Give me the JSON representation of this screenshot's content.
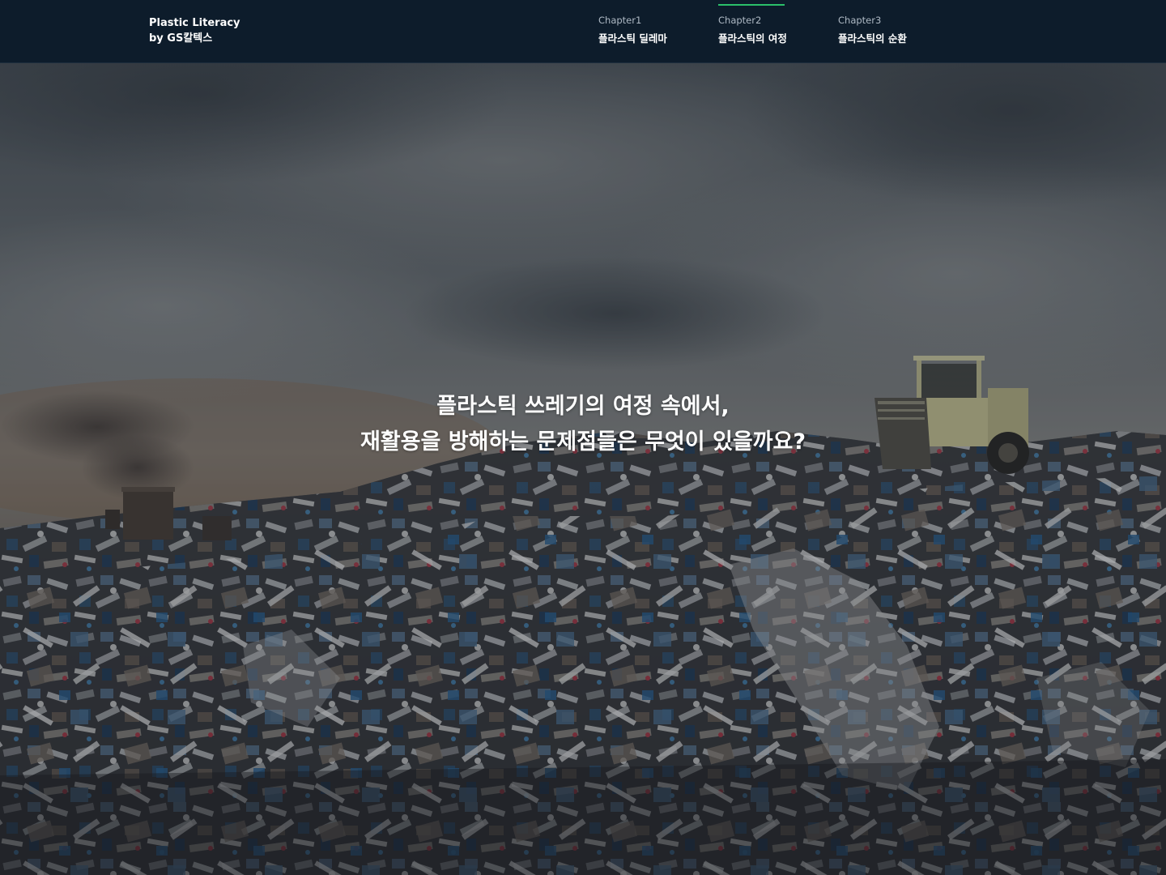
{
  "brand": {
    "line1": "Plastic Literacy",
    "line2": "by GS칼텍스"
  },
  "nav": {
    "items": [
      {
        "chapter": "Chapter1",
        "title": "플라스틱 딜레마",
        "active": false
      },
      {
        "chapter": "Chapter2",
        "title": "플라스틱의 여정",
        "active": true
      },
      {
        "chapter": "Chapter3",
        "title": "플라스틱의 순환",
        "active": false
      }
    ]
  },
  "hero": {
    "headline_line1": "플라스틱 쓰레기의 여정 속에서,",
    "headline_line2": "재활용을 방해하는 문제점들은 무엇이 있을까요?"
  },
  "colors": {
    "header_bg": "#0d1c2b",
    "accent": "#2bbf6a",
    "text_primary": "#ffffff",
    "text_secondary": "#aeb9c4"
  }
}
